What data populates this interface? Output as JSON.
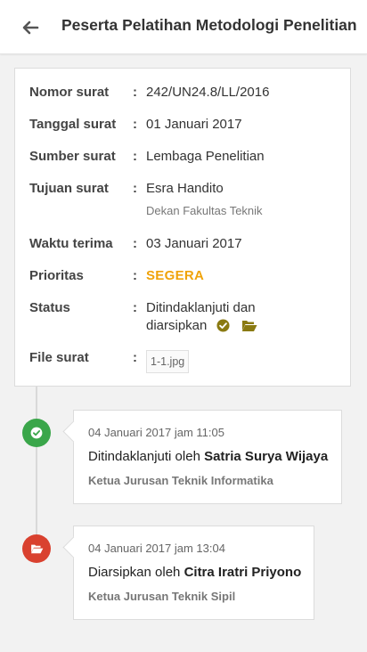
{
  "header": {
    "title": "Peserta Pelatihan Metodologi Penelitian",
    "back_icon": "arrow-left-icon"
  },
  "details": {
    "nomor_label": "Nomor surat",
    "nomor_value": "242/UN24.8/LL/2016",
    "tanggal_label": "Tanggal surat",
    "tanggal_value": "01 Januari 2017",
    "sumber_label": "Sumber surat",
    "sumber_value": "Lembaga Penelitian",
    "tujuan_label": "Tujuan surat",
    "tujuan_value": "Esra Handito",
    "tujuan_sub": "Dekan Fakultas Teknik",
    "waktu_label": "Waktu terima",
    "waktu_value": "03 Januari 2017",
    "prioritas_label": "Prioritas",
    "prioritas_value": "SEGERA",
    "status_label": "Status",
    "status_value_line1": "Ditindaklanjuti dan",
    "status_value_line2": "diarsipkan",
    "file_label": "File surat",
    "file_value": "1-1.jpg",
    "separator": ":"
  },
  "timeline": [
    {
      "time": "04 Januari 2017 jam 11:05",
      "action_prefix": "Ditindaklanjuti oleh ",
      "person": "Satria Surya Wijaya",
      "role": "Ketua Jurusan Teknik Informatika",
      "icon": "check-circle-icon"
    },
    {
      "time": "04 Januari 2017 jam 13:04",
      "action_prefix": "Diarsipkan oleh ",
      "person": "Citra Iratri Priyono",
      "role": "Ketua Jurusan Teknik Sipil",
      "icon": "folder-open-icon"
    }
  ],
  "colors": {
    "accent_orange": "#f0a30a",
    "success_green": "#3aa64a",
    "archive_red": "#d9412f",
    "icon_olive": "#8a7a12"
  }
}
